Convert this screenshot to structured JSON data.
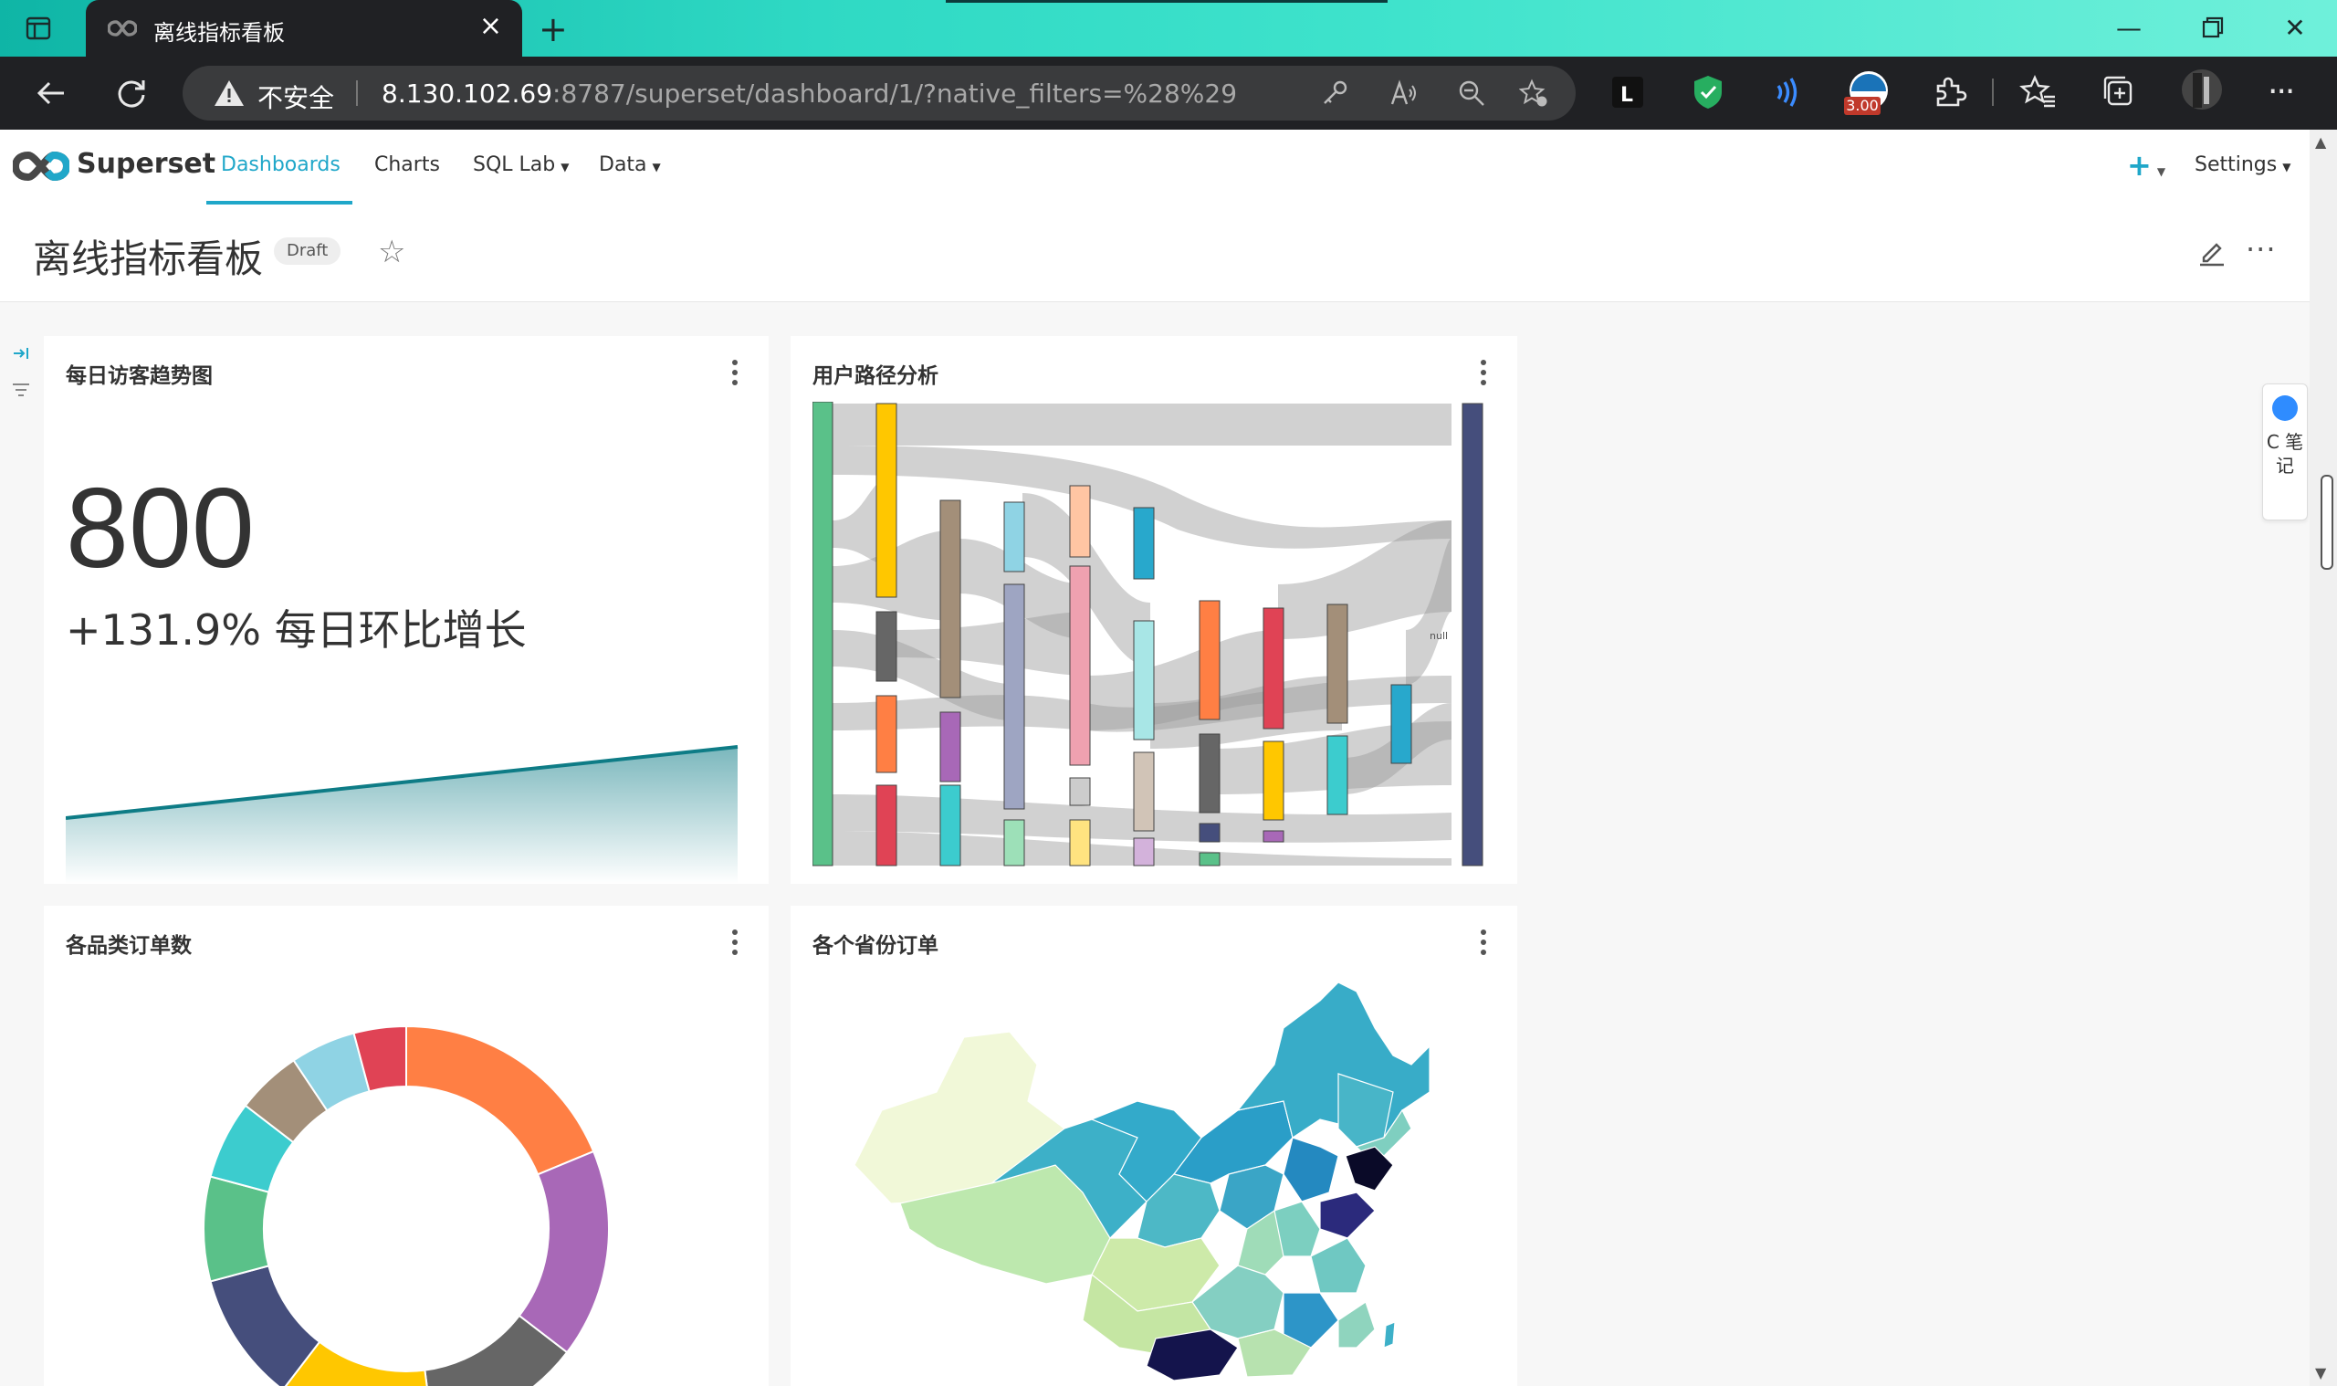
{
  "browser": {
    "tab_title": "离线指标看板",
    "security_label": "不安全",
    "url_host": "8.130.102.69",
    "url_rest": ":8787/superset/dashboard/1/?native_filters=%28%29",
    "extension_badge": "3.00"
  },
  "superset": {
    "brand": "Superset",
    "menu": [
      {
        "label": "Dashboards",
        "active": true
      },
      {
        "label": "Charts",
        "active": false
      },
      {
        "label": "SQL Lab",
        "active": false,
        "dropdown": true
      },
      {
        "label": "Data",
        "active": false,
        "dropdown": true
      }
    ],
    "settings_label": "Settings",
    "accent_color": "#20a7c9"
  },
  "dashboard": {
    "title": "离线指标看板",
    "status": "Draft"
  },
  "cards": {
    "visitors": {
      "title": "每日访客趋势图",
      "big_number": "800",
      "subheader": "+131.9% 每日环比增长",
      "trend": [
        0.0,
        1.0
      ]
    },
    "sankey": {
      "title": "用户路径分析",
      "node_label": "null"
    },
    "category_orders": {
      "title": "各品类订单数",
      "slices": [
        {
          "value": 18,
          "color": "#ff7f44"
        },
        {
          "value": 16,
          "color": "#a868b7"
        },
        {
          "value": 12,
          "color": "#666666"
        },
        {
          "value": 12,
          "color": "#ffc700"
        },
        {
          "value": 10,
          "color": "#454e7c"
        },
        {
          "value": 8,
          "color": "#5ac189"
        },
        {
          "value": 6,
          "color": "#3cccce"
        },
        {
          "value": 5,
          "color": "#a38f79"
        },
        {
          "value": 5,
          "color": "#8fd3e4"
        },
        {
          "value": 4,
          "color": "#e04355"
        }
      ]
    },
    "province_orders": {
      "title": "各个省份订单"
    }
  },
  "side_note": {
    "label": "C 笔 记"
  }
}
